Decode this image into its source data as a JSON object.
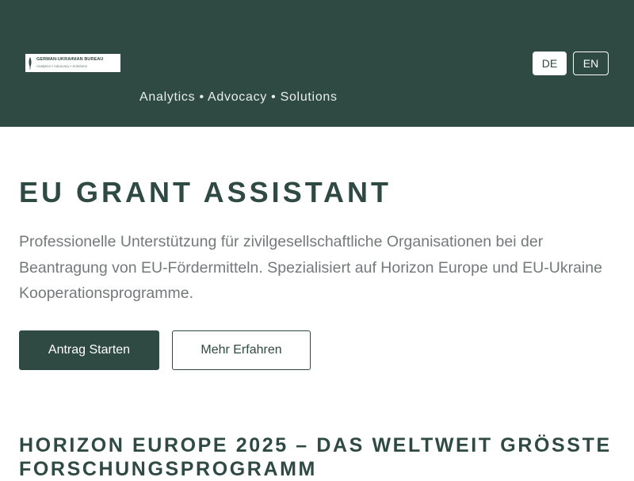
{
  "header": {
    "logo": {
      "name": "GERMAN-UKRAINIAN BUREAU",
      "tagline": "Analytics  •  Advocacy  •  Solutions",
      "icon": "leaf-icon"
    },
    "tagline": "Analytics • Advocacy • Solutions",
    "languages": [
      {
        "label": "DE",
        "active": true
      },
      {
        "label": "EN",
        "active": false
      }
    ]
  },
  "hero": {
    "title": "EU GRANT ASSISTANT",
    "description": "Professionelle Unterstützung für zivilgesellschaftliche Organisationen bei der Beantragung von EU-Fördermitteln. Spezialisiert auf Horizon Europe und EU-Ukraine Kooperationsprogramme.",
    "primary_button": "Antrag Starten",
    "secondary_button": "Mehr Erfahren"
  },
  "section": {
    "title": "HORIZON EUROPE 2025 – DAS WELTWEIT GRÖSSTE FORSCHUNGSPROGRAMM"
  },
  "colors": {
    "brand": "#2f4a43",
    "text_muted": "#74797a",
    "background": "#ffffff"
  }
}
